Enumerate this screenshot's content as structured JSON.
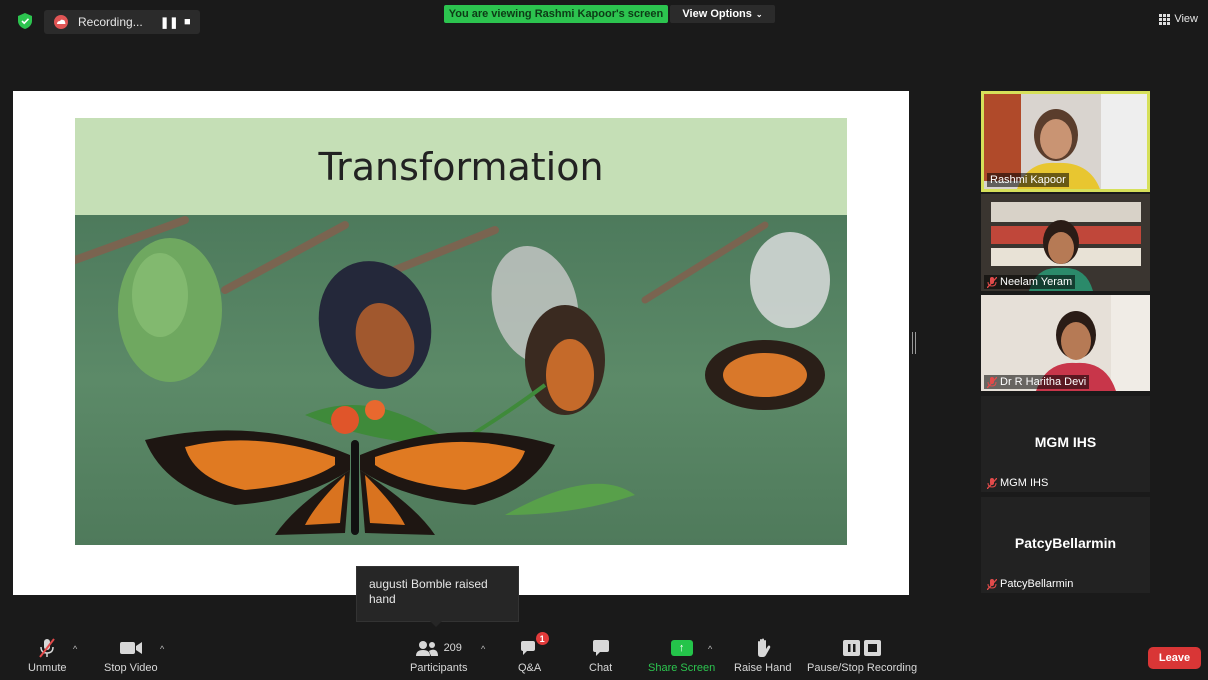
{
  "top_bar": {
    "recording_label": "Recording...",
    "viewing_banner": "You are viewing Rashmi Kapoor's screen",
    "view_options_label": "View Options",
    "view_label": "View"
  },
  "slide": {
    "title": "Transformation"
  },
  "gallery": {
    "tiles": [
      {
        "name": "Rashmi Kapoor",
        "muted": false,
        "video": true
      },
      {
        "name": "Neelam Yeram",
        "muted": true,
        "video": true
      },
      {
        "name": "Dr R Haritha Devi",
        "muted": true,
        "video": true
      },
      {
        "name": "MGM IHS",
        "display_name": "MGM IHS",
        "muted": true,
        "video": false
      },
      {
        "name": "PatcyBellarmin",
        "display_name": "PatcyBellarmin",
        "muted": true,
        "video": false
      }
    ]
  },
  "toast": {
    "message": "augusti Bomble raised hand"
  },
  "toolbar": {
    "unmute_label": "Unmute",
    "stop_video_label": "Stop Video",
    "participants_label": "Participants",
    "participants_count": "209",
    "qa_label": "Q&A",
    "qa_badge": "1",
    "chat_label": "Chat",
    "share_screen_label": "Share Screen",
    "raise_hand_label": "Raise Hand",
    "recording_label": "Pause/Stop Recording",
    "leave_label": "Leave"
  },
  "colors": {
    "accent_green": "#2cc44f",
    "active_speaker_border": "#d6e05a",
    "leave_red": "#d93636",
    "slide_title_band": "#c5dfb6"
  }
}
